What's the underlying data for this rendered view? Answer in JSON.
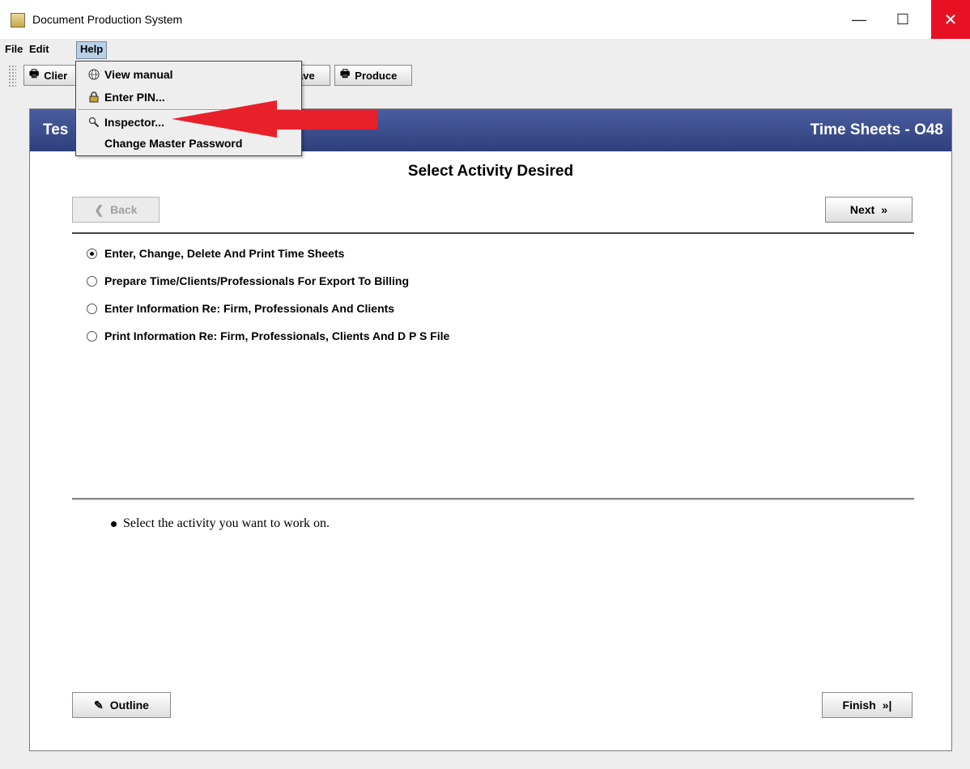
{
  "window": {
    "title": "Document Production System",
    "minimize": "—",
    "maximize": "☐",
    "close": "✕"
  },
  "menubar": {
    "file": "File",
    "edit": "Edit",
    "help": "Help"
  },
  "toolbar": {
    "client_label": "Clier",
    "save_label": "ave",
    "produce_label": "Produce"
  },
  "help_menu": {
    "items": [
      {
        "label": "View manual",
        "icon": "globe-icon"
      },
      {
        "label": "Enter PIN...",
        "icon": "lock-icon"
      },
      {
        "label": "Inspector...",
        "icon": "magnifier-icon"
      },
      {
        "label": "Change Master Password",
        "icon": ""
      }
    ]
  },
  "banner": {
    "left": "Tes",
    "right": "Time Sheets - O48"
  },
  "page": {
    "heading": "Select Activity Desired",
    "help_text": "Select the activity you want to work on."
  },
  "nav": {
    "back": "Back",
    "next": "Next",
    "outline": "Outline",
    "finish": "Finish"
  },
  "options": [
    {
      "label": "Enter, Change, Delete And Print Time Sheets",
      "selected": true
    },
    {
      "label": "Prepare Time/Clients/Professionals For Export To Billing",
      "selected": false
    },
    {
      "label": "Enter Information Re: Firm, Professionals And Clients",
      "selected": false
    },
    {
      "label": "Print Information Re: Firm, Professionals, Clients And D P S File",
      "selected": false
    }
  ],
  "colors": {
    "banner": "#2e3f7c",
    "arrow": "#e8202a",
    "close": "#e81123",
    "menu_highlight": "#b8cfe5"
  }
}
